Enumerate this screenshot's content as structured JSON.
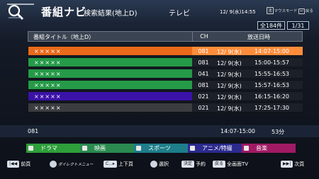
{
  "header": {
    "title": "番組ナビ",
    "subtitle": "検索結果(地上D)",
    "channel": "テレビ",
    "clock": "12/ 9(水)14:55",
    "icon_keys": [
      "消",
      "マウスモード",
      "戻る"
    ],
    "count": "全184件",
    "page": "1/31"
  },
  "table": {
    "columns": [
      "番組タイトル（地上D）",
      "CH",
      "放送日時"
    ],
    "rows": [
      {
        "title": "×××××",
        "ch": "081",
        "date": "12/ 9(水)",
        "time": "14:07-15:00",
        "color": "#e96a1a",
        "selected": true
      },
      {
        "title": "×××××",
        "ch": "081",
        "date": "12/ 9(水)",
        "time": "15:00-15:57",
        "color": "#259a48",
        "selected": false
      },
      {
        "title": "×××××",
        "ch": "041",
        "date": "12/ 9(水)",
        "time": "15:55-16:53",
        "color": "#259a48",
        "selected": false
      },
      {
        "title": "×××××",
        "ch": "081",
        "date": "12/ 9(水)",
        "time": "15:57-16:53",
        "color": "#259a48",
        "selected": false
      },
      {
        "title": "×××××",
        "ch": "021",
        "date": "12/ 9(水)",
        "time": "16:15-16:20",
        "color": "#3b12a8",
        "selected": false
      },
      {
        "title": "×××××",
        "ch": "021",
        "date": "12/ 9(水)",
        "time": "17:25-17:30",
        "color": "#3a3c40",
        "selected": false
      }
    ]
  },
  "info": {
    "channel": "081",
    "time": "14:07-15:00",
    "duration": "53分"
  },
  "genres": [
    {
      "label": "ドラマ",
      "color": "#2e9e3a",
      "icon": "drama-icon"
    },
    {
      "label": "映画",
      "color": "#2a8a50",
      "icon": "movie-icon"
    },
    {
      "label": "スポーツ",
      "color": "#1e7e8a",
      "icon": "sports-icon"
    },
    {
      "label": "アニメ/特撮",
      "color": "#2b2a8e",
      "icon": "anime-icon"
    },
    {
      "label": "音楽",
      "color": "#a01a64",
      "icon": "music-icon"
    }
  ],
  "footer": {
    "prev": "前頁",
    "direct": "ダイレクトメニュー",
    "updown": "上下頁",
    "select": "選択",
    "decide_key": "決定",
    "reserve": "予約",
    "back_key": "戻る",
    "fullscreen": "全画面TV",
    "next": "次頁"
  }
}
